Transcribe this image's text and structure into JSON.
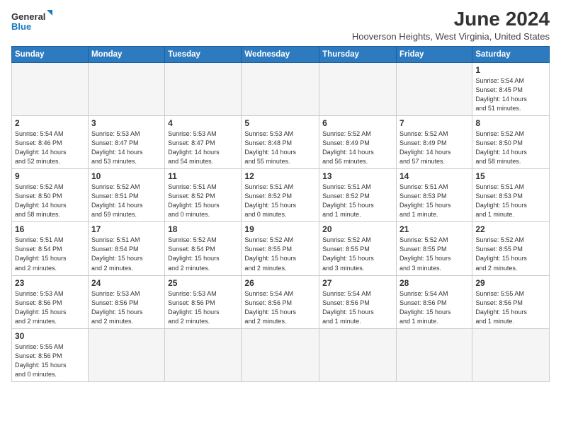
{
  "header": {
    "logo_general": "General",
    "logo_blue": "Blue",
    "month_year": "June 2024",
    "subtitle": "Hooverson Heights, West Virginia, United States"
  },
  "days_of_week": [
    "Sunday",
    "Monday",
    "Tuesday",
    "Wednesday",
    "Thursday",
    "Friday",
    "Saturday"
  ],
  "weeks": [
    [
      {
        "day": "",
        "info": ""
      },
      {
        "day": "",
        "info": ""
      },
      {
        "day": "",
        "info": ""
      },
      {
        "day": "",
        "info": ""
      },
      {
        "day": "",
        "info": ""
      },
      {
        "day": "",
        "info": ""
      },
      {
        "day": "1",
        "info": "Sunrise: 5:54 AM\nSunset: 8:45 PM\nDaylight: 14 hours\nand 51 minutes."
      }
    ],
    [
      {
        "day": "2",
        "info": "Sunrise: 5:54 AM\nSunset: 8:46 PM\nDaylight: 14 hours\nand 52 minutes."
      },
      {
        "day": "3",
        "info": "Sunrise: 5:53 AM\nSunset: 8:47 PM\nDaylight: 14 hours\nand 53 minutes."
      },
      {
        "day": "4",
        "info": "Sunrise: 5:53 AM\nSunset: 8:47 PM\nDaylight: 14 hours\nand 54 minutes."
      },
      {
        "day": "5",
        "info": "Sunrise: 5:53 AM\nSunset: 8:48 PM\nDaylight: 14 hours\nand 55 minutes."
      },
      {
        "day": "6",
        "info": "Sunrise: 5:52 AM\nSunset: 8:49 PM\nDaylight: 14 hours\nand 56 minutes."
      },
      {
        "day": "7",
        "info": "Sunrise: 5:52 AM\nSunset: 8:49 PM\nDaylight: 14 hours\nand 57 minutes."
      },
      {
        "day": "8",
        "info": "Sunrise: 5:52 AM\nSunset: 8:50 PM\nDaylight: 14 hours\nand 58 minutes."
      }
    ],
    [
      {
        "day": "9",
        "info": "Sunrise: 5:52 AM\nSunset: 8:50 PM\nDaylight: 14 hours\nand 58 minutes."
      },
      {
        "day": "10",
        "info": "Sunrise: 5:52 AM\nSunset: 8:51 PM\nDaylight: 14 hours\nand 59 minutes."
      },
      {
        "day": "11",
        "info": "Sunrise: 5:51 AM\nSunset: 8:52 PM\nDaylight: 15 hours\nand 0 minutes."
      },
      {
        "day": "12",
        "info": "Sunrise: 5:51 AM\nSunset: 8:52 PM\nDaylight: 15 hours\nand 0 minutes."
      },
      {
        "day": "13",
        "info": "Sunrise: 5:51 AM\nSunset: 8:52 PM\nDaylight: 15 hours\nand 1 minute."
      },
      {
        "day": "14",
        "info": "Sunrise: 5:51 AM\nSunset: 8:53 PM\nDaylight: 15 hours\nand 1 minute."
      },
      {
        "day": "15",
        "info": "Sunrise: 5:51 AM\nSunset: 8:53 PM\nDaylight: 15 hours\nand 1 minute."
      }
    ],
    [
      {
        "day": "16",
        "info": "Sunrise: 5:51 AM\nSunset: 8:54 PM\nDaylight: 15 hours\nand 2 minutes."
      },
      {
        "day": "17",
        "info": "Sunrise: 5:51 AM\nSunset: 8:54 PM\nDaylight: 15 hours\nand 2 minutes."
      },
      {
        "day": "18",
        "info": "Sunrise: 5:52 AM\nSunset: 8:54 PM\nDaylight: 15 hours\nand 2 minutes."
      },
      {
        "day": "19",
        "info": "Sunrise: 5:52 AM\nSunset: 8:55 PM\nDaylight: 15 hours\nand 2 minutes."
      },
      {
        "day": "20",
        "info": "Sunrise: 5:52 AM\nSunset: 8:55 PM\nDaylight: 15 hours\nand 3 minutes."
      },
      {
        "day": "21",
        "info": "Sunrise: 5:52 AM\nSunset: 8:55 PM\nDaylight: 15 hours\nand 3 minutes."
      },
      {
        "day": "22",
        "info": "Sunrise: 5:52 AM\nSunset: 8:55 PM\nDaylight: 15 hours\nand 2 minutes."
      }
    ],
    [
      {
        "day": "23",
        "info": "Sunrise: 5:53 AM\nSunset: 8:56 PM\nDaylight: 15 hours\nand 2 minutes."
      },
      {
        "day": "24",
        "info": "Sunrise: 5:53 AM\nSunset: 8:56 PM\nDaylight: 15 hours\nand 2 minutes."
      },
      {
        "day": "25",
        "info": "Sunrise: 5:53 AM\nSunset: 8:56 PM\nDaylight: 15 hours\nand 2 minutes."
      },
      {
        "day": "26",
        "info": "Sunrise: 5:54 AM\nSunset: 8:56 PM\nDaylight: 15 hours\nand 2 minutes."
      },
      {
        "day": "27",
        "info": "Sunrise: 5:54 AM\nSunset: 8:56 PM\nDaylight: 15 hours\nand 1 minute."
      },
      {
        "day": "28",
        "info": "Sunrise: 5:54 AM\nSunset: 8:56 PM\nDaylight: 15 hours\nand 1 minute."
      },
      {
        "day": "29",
        "info": "Sunrise: 5:55 AM\nSunset: 8:56 PM\nDaylight: 15 hours\nand 1 minute."
      }
    ],
    [
      {
        "day": "30",
        "info": "Sunrise: 5:55 AM\nSunset: 8:56 PM\nDaylight: 15 hours\nand 0 minutes."
      },
      {
        "day": "",
        "info": ""
      },
      {
        "day": "",
        "info": ""
      },
      {
        "day": "",
        "info": ""
      },
      {
        "day": "",
        "info": ""
      },
      {
        "day": "",
        "info": ""
      },
      {
        "day": "",
        "info": ""
      }
    ]
  ]
}
